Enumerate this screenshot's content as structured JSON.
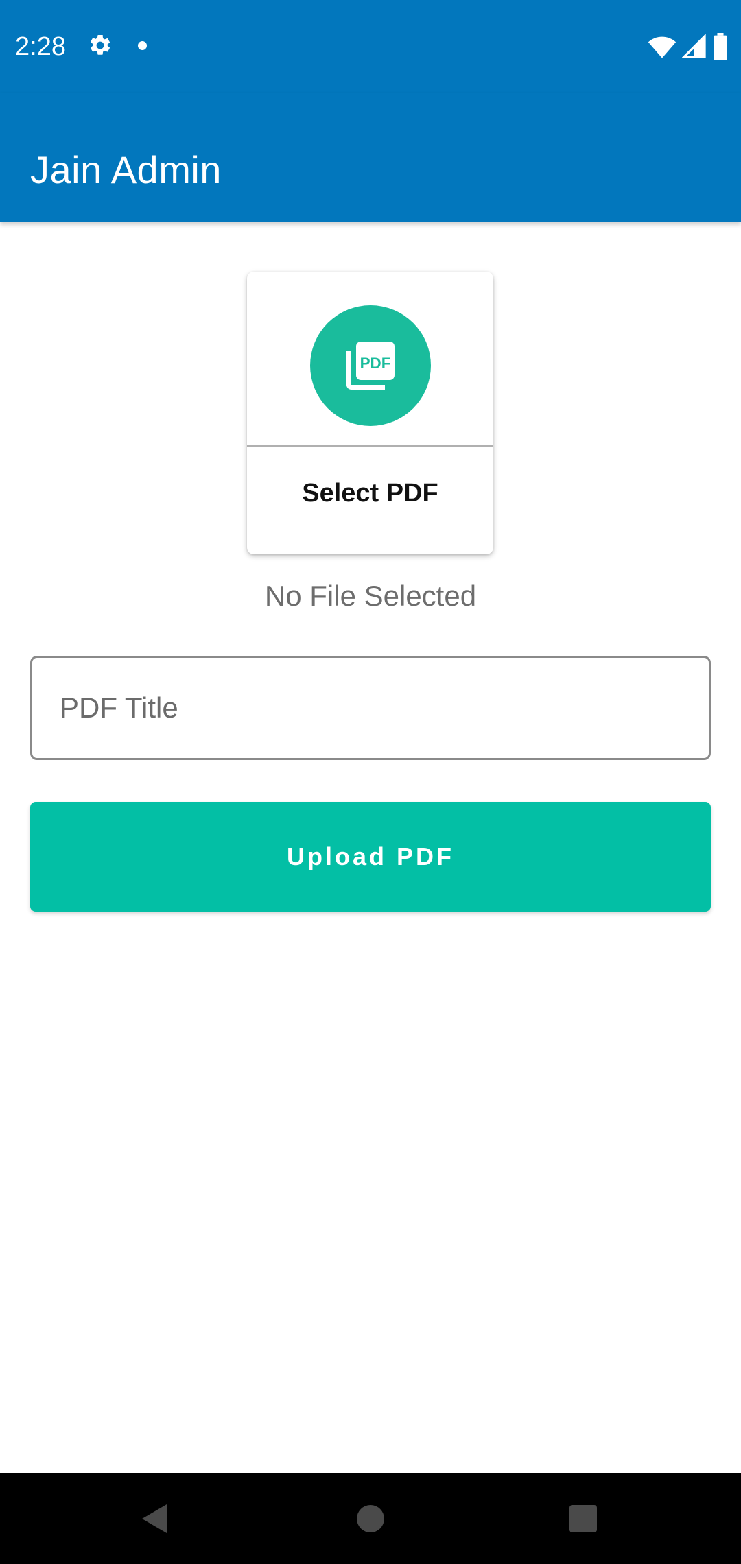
{
  "status_bar": {
    "time": "2:28",
    "icons": [
      "gear-icon",
      "notification-dot-icon",
      "wifi-icon",
      "signal-icon",
      "battery-icon"
    ]
  },
  "app_bar": {
    "title": "Jain Admin"
  },
  "select_card": {
    "label": "Select PDF",
    "icon": "pdf-icon",
    "icon_text": "PDF",
    "accent_color": "#1abc9c"
  },
  "file_status": {
    "text": "No File Selected"
  },
  "pdf_title_field": {
    "value": "",
    "placeholder": "PDF Title"
  },
  "upload_button": {
    "label": "Upload PDF",
    "color": "#03bfa5"
  },
  "nav_bar": {
    "icons": [
      "back-icon",
      "home-icon",
      "recents-icon"
    ]
  },
  "colors": {
    "primary": "#0277bd",
    "accent": "#03bfa5"
  }
}
